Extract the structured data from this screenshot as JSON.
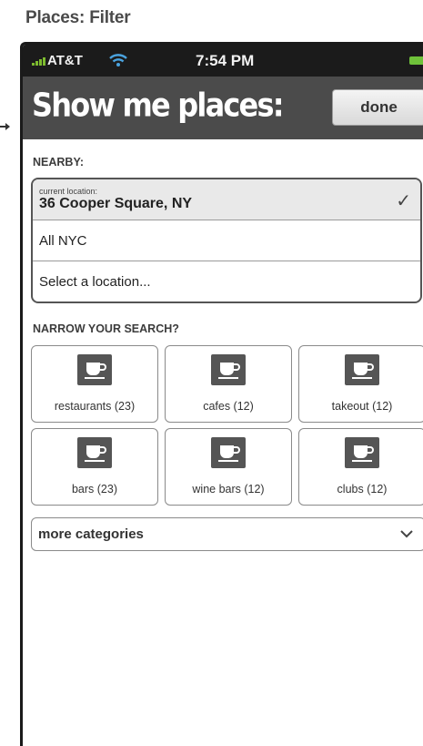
{
  "page_title": "Places: Filter",
  "status_bar": {
    "carrier": "AT&T",
    "time": "7:54 PM"
  },
  "nav": {
    "title": "Show me places:",
    "done_label": "done"
  },
  "nearby": {
    "label": "NEARBY:",
    "current_location_caption": "current location:",
    "current_location_value": "36 Cooper Square, NY",
    "option_all": "All NYC",
    "option_select": "Select a location..."
  },
  "narrow": {
    "label": "NARROW YOUR SEARCH?",
    "categories": [
      {
        "label": "restaurants (23)",
        "icon": "coffee-cup-icon"
      },
      {
        "label": "cafes (12)",
        "icon": "coffee-cup-icon"
      },
      {
        "label": "takeout (12)",
        "icon": "coffee-cup-icon"
      },
      {
        "label": "bars (23)",
        "icon": "coffee-cup-icon"
      },
      {
        "label": "wine bars (12)",
        "icon": "coffee-cup-icon"
      },
      {
        "label": "clubs (12)",
        "icon": "coffee-cup-icon"
      }
    ],
    "more_label": "more categories"
  },
  "colors": {
    "status_bar": "#1b1b1b",
    "nav_bar": "#4b4b4b",
    "signal": "#7dbb2f",
    "battery": "#6fc23a",
    "icon_fill": "#555555"
  }
}
